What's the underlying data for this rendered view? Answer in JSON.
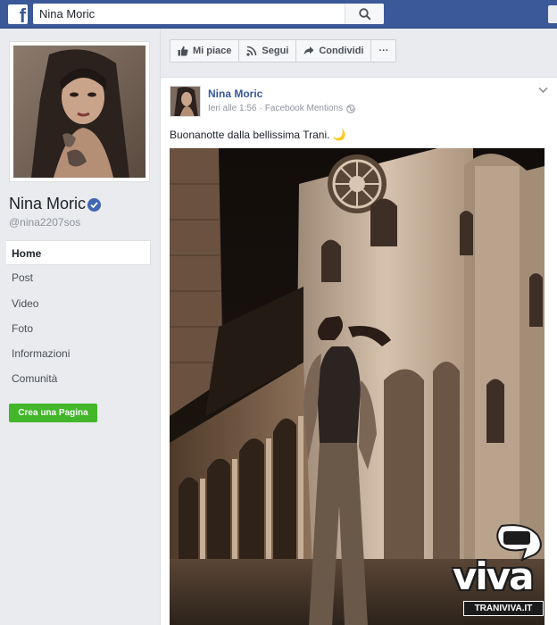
{
  "topbar": {
    "search_value": "Nina Moric"
  },
  "sidebar": {
    "page_name": "Nina Moric",
    "handle": "@nina2207sos",
    "nav": [
      {
        "label": "Home"
      },
      {
        "label": "Post"
      },
      {
        "label": "Video"
      },
      {
        "label": "Foto"
      },
      {
        "label": "Informazioni"
      },
      {
        "label": "Comunità"
      }
    ],
    "create_page_label": "Crea una Pagina"
  },
  "actions": {
    "like_label": "Mi piace",
    "follow_label": "Segui",
    "share_label": "Condividi",
    "more_label": "···"
  },
  "post": {
    "author": "Nina Moric",
    "time": "Ieri alle 1:56",
    "separator": "·",
    "source": "Facebook Mentions",
    "text": "Buonanotte dalla bellissima Trani. 🌙"
  },
  "watermark": {
    "brand": "viva",
    "site": "TRANIVIVA.IT"
  },
  "colors": {
    "facebook_blue": "#3b5998",
    "link_blue": "#365899",
    "verified_blue": "#4267b2",
    "create_green": "#42b72a"
  }
}
